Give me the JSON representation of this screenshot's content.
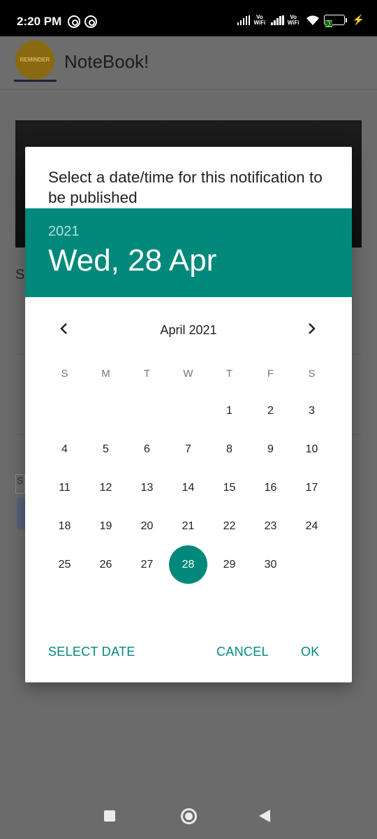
{
  "status_bar": {
    "time": "2:20 PM",
    "vowifi_1": "Vo\nWiFi",
    "vowifi_2": "Vo\nWiFi",
    "battery": "93"
  },
  "app": {
    "title": "NoteBook!",
    "logo_text": "REMINDER",
    "bg_letter": "S",
    "bg_input_text": "S"
  },
  "dialog": {
    "title": "Select a date/time for this notification to be published",
    "header_year": "2021",
    "header_date": "Wed, 28 Apr",
    "month_label": "April 2021",
    "weekdays": [
      "S",
      "M",
      "T",
      "W",
      "T",
      "F",
      "S"
    ],
    "days": [
      "1",
      "2",
      "3",
      "4",
      "5",
      "6",
      "7",
      "8",
      "9",
      "10",
      "11",
      "12",
      "13",
      "14",
      "15",
      "16",
      "17",
      "18",
      "19",
      "20",
      "21",
      "22",
      "23",
      "24",
      "25",
      "26",
      "27",
      "28",
      "29",
      "30"
    ],
    "selected_day": "28",
    "accent_color": "#00897b",
    "actions": {
      "select_date": "SELECT DATE",
      "cancel": "CANCEL",
      "ok": "OK"
    }
  },
  "nav_bar": {
    "icons": [
      "recents-icon",
      "home-icon",
      "back-icon"
    ]
  }
}
